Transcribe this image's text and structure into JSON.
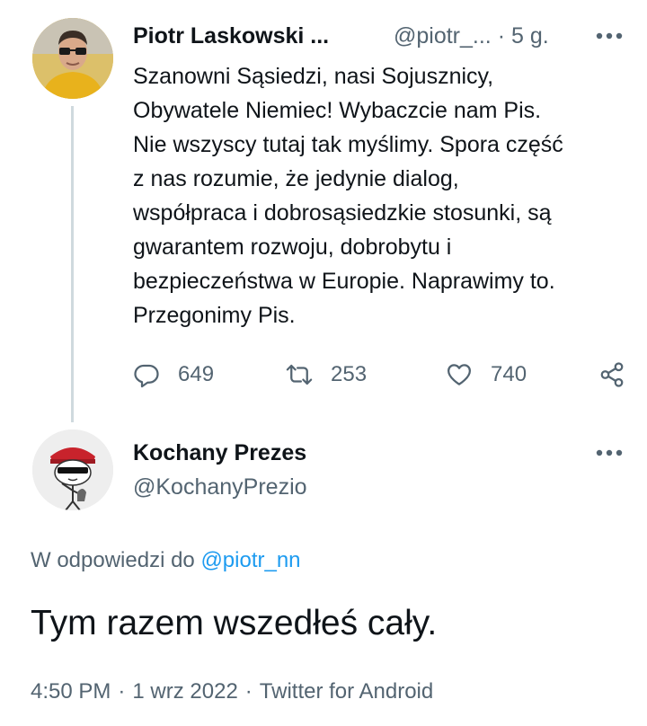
{
  "tweet": {
    "author_name": "Piotr Laskowski ...",
    "author_handle_time": "@piotr_... · 5 g.",
    "text_lines": [
      "Szanowni Sąsiedzi, nasi Sojusznicy,",
      "Obywatele Niemiec! Wybaczcie nam Pis.",
      "Nie wszyscy tutaj tak myślimy. Spora część",
      "z nas rozumie, że jedynie dialog,",
      "współpraca i dobrosąsiedzkie stosunki, są",
      "gwarantem rozwoju, dobrobytu i",
      "bezpieczeństwa w Europie. Naprawimy to.",
      "Przegonimy Pis."
    ],
    "reply_count": "649",
    "retweet_count": "253",
    "like_count": "740"
  },
  "reply": {
    "author_name": "Kochany Prezes",
    "author_handle": "@KochanyPrezio",
    "in_reply_prefix": "W odpowiedzi do ",
    "in_reply_handle": "@piotr_nn",
    "text": "Tym razem wszedłeś cały.",
    "time": "4:50 PM",
    "date": "1 wrz 2022",
    "source": "Twitter for Android",
    "separator": "·"
  },
  "icons": {
    "reply": "reply-icon",
    "retweet": "retweet-icon",
    "like": "heart-icon",
    "share": "share-icon",
    "more": "more-icon"
  },
  "colors": {
    "text": "#0f1419",
    "secondary": "#536471",
    "link": "#1d9bf0",
    "thread_line": "#cfd9de"
  }
}
